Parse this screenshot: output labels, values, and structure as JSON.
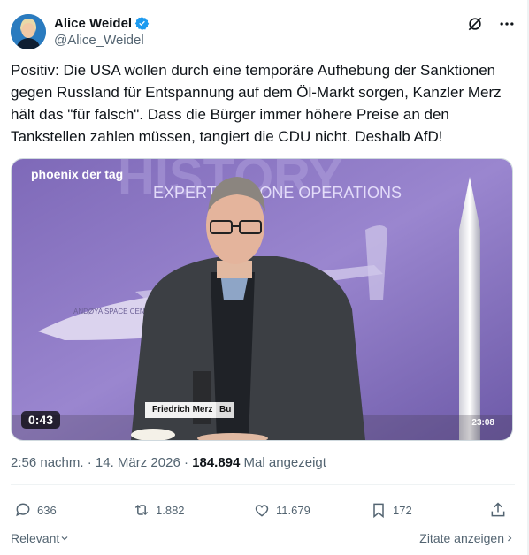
{
  "author": {
    "name": "Alice Weidel",
    "handle": "@Alice_Weidel",
    "verified_color": "#1d9bf0"
  },
  "icons": {
    "grok": "grok-icon",
    "more": "more-icon",
    "reply": "reply-icon",
    "repost": "repost-icon",
    "like": "heart-icon",
    "bookmark": "bookmark-icon",
    "share": "share-icon"
  },
  "tweet": {
    "text": "Positiv: Die USA wollen durch eine temporäre Aufhebung der Sanktionen gegen Russland für Entspannung auf dem Öl-Markt sorgen, Kanzler Merz hält das \"für falsch\". Dass die Bürger immer höhere Preise an den Tankstellen zahlen müssen, tangiert die CDU nicht. Deshalb AfD!"
  },
  "video": {
    "channel_logo": "phoenix der tag",
    "banner_text": "EXPERT  N DRONE OPERATIONS",
    "side_label": "ANDØYA SPACE CENTER",
    "lower_third_name": "Friedrich Merz",
    "lower_third_tail": "Bu",
    "duration": "0:43",
    "clock": "23:08",
    "bg_color": "#8a76c2"
  },
  "meta": {
    "time": "2:56 nachm.",
    "date": "14. März 2026",
    "dot": "·",
    "views": "184.894",
    "views_label": "Mal angezeigt"
  },
  "actions": {
    "replies": "636",
    "reposts": "1.882",
    "likes": "11.679",
    "bookmarks": "172"
  },
  "footer": {
    "left": "Relevant",
    "right": "Zitate anzeigen"
  }
}
